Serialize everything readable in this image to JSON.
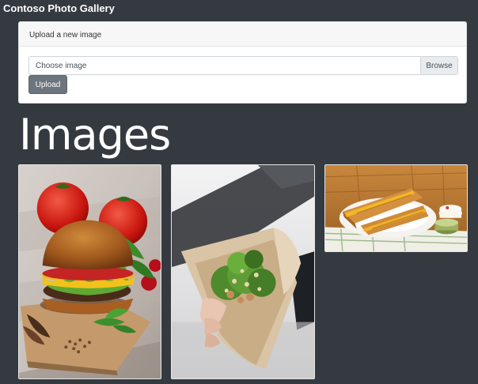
{
  "app": {
    "title": "Contoso Photo Gallery"
  },
  "upload": {
    "header": "Upload a new image",
    "file_placeholder": "Choose image",
    "browse_label": "Browse",
    "upload_label": "Upload"
  },
  "gallery": {
    "heading": "Images",
    "items": [
      {
        "subject": "burger with tomatoes and mint"
      },
      {
        "subject": "salad in paper cone"
      },
      {
        "subject": "toasted sandwich on plate"
      }
    ]
  },
  "colors": {
    "background": "#343a40",
    "button": "#6c757d",
    "card": "#ffffff"
  }
}
